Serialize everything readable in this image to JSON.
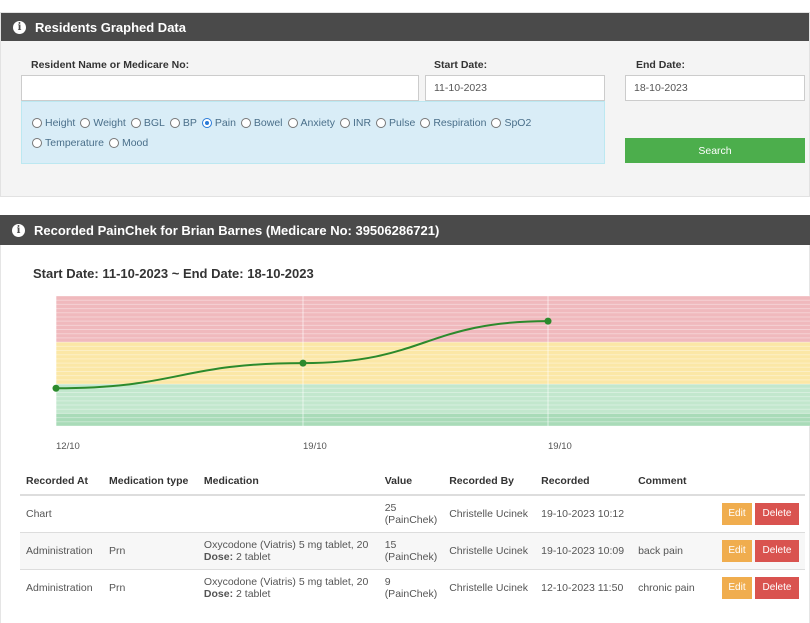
{
  "search_panel": {
    "title": "Residents Graphed Data",
    "resident_label": "Resident Name or Medicare No:",
    "resident_value": "",
    "start_label": "Start Date:",
    "start_value": "11-10-2023",
    "end_label": "End Date:",
    "end_value": "18-10-2023",
    "options": [
      {
        "label": "Height",
        "checked": false
      },
      {
        "label": "Weight",
        "checked": false
      },
      {
        "label": "BGL",
        "checked": false
      },
      {
        "label": "BP",
        "checked": false
      },
      {
        "label": "Pain",
        "checked": true
      },
      {
        "label": "Bowel",
        "checked": false
      },
      {
        "label": "Anxiety",
        "checked": false
      },
      {
        "label": "INR",
        "checked": false
      },
      {
        "label": "Pulse",
        "checked": false
      },
      {
        "label": "Respiration",
        "checked": false
      },
      {
        "label": "SpO2",
        "checked": false
      },
      {
        "label": "Temperature",
        "checked": false
      },
      {
        "label": "Mood",
        "checked": false
      }
    ],
    "search_label": "Search"
  },
  "results_panel": {
    "title": "Recorded PainChek for Brian Barnes (Medicare No: 39506286721)",
    "range": "Start Date: 11-10-2023 ~ End Date: 18-10-2023"
  },
  "chart_data": {
    "type": "line",
    "x_ticks": [
      "12/10",
      "19/10",
      "19/10"
    ],
    "points": [
      {
        "x": "12/10",
        "y": 9
      },
      {
        "x": "19/10",
        "y": 15
      },
      {
        "x": "19/10",
        "y": 25
      }
    ],
    "bands": [
      {
        "from": 0,
        "to": 3,
        "color": "#a9dbb8"
      },
      {
        "from": 3,
        "to": 10,
        "color": "#c2e7cd"
      },
      {
        "from": 10,
        "to": 20,
        "color": "#fbe7a6"
      },
      {
        "from": 20,
        "to": 31,
        "color": "#f0b9bd"
      }
    ],
    "ylim": [
      0,
      31
    ],
    "line_color": "#2c8a2c",
    "grid": true
  },
  "table": {
    "headers": [
      "Recorded At",
      "Medication type",
      "Medication",
      "Value",
      "Recorded By",
      "Recorded",
      "Comment"
    ],
    "rows": [
      {
        "recorded_at": "Chart",
        "med_type": "",
        "medication": "",
        "dose_label": "",
        "dose_value": "",
        "value_num": "25",
        "value_unit": "(PainChek)",
        "recorded_by": "Christelle Ucinek",
        "recorded": "19-10-2023 10:12",
        "comment": "",
        "edit": "Edit",
        "delete": "Delete"
      },
      {
        "recorded_at": "Administration",
        "med_type": "Prn",
        "medication": "Oxycodone (Viatris) 5 mg tablet, 20",
        "dose_label": "Dose:",
        "dose_value": "2 tablet",
        "value_num": "15",
        "value_unit": "(PainChek)",
        "recorded_by": "Christelle Ucinek",
        "recorded": "19-10-2023 10:09",
        "comment": "back pain",
        "edit": "Edit",
        "delete": "Delete"
      },
      {
        "recorded_at": "Administration",
        "med_type": "Prn",
        "medication": "Oxycodone (Viatris) 5 mg tablet, 20",
        "dose_label": "Dose:",
        "dose_value": "2 tablet",
        "value_num": "9",
        "value_unit": "(PainChek)",
        "recorded_by": "Christelle Ucinek",
        "recorded": "12-10-2023 11:50",
        "comment": "chronic pain",
        "edit": "Edit",
        "delete": "Delete"
      }
    ]
  },
  "colors": {
    "header_bg": "#4a4a4a",
    "search_green": "#4cae4c",
    "edit_orange": "#f0ad4e",
    "delete_red": "#d9534f"
  }
}
